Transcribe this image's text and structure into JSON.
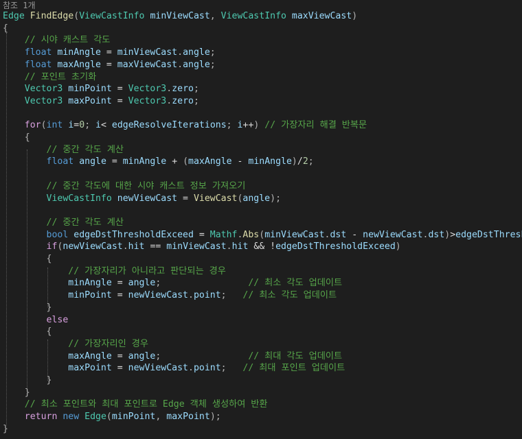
{
  "codelens": {
    "references": "참조 1개"
  },
  "theme": {
    "background": "#1e1e1e",
    "function": "#dcdcaa",
    "type": "#4ec9b0",
    "keyword": "#569cd6",
    "control": "#d8a0df",
    "variable": "#9cdcfe",
    "number": "#b5cea8",
    "comment": "#57a64a",
    "punctuation": "#b4b4b4",
    "plain": "#dcdcdc"
  },
  "code": [
    [
      [
        "type",
        "Edge"
      ],
      [
        "plain",
        " "
      ],
      [
        "fn",
        "FindEdge"
      ],
      [
        "punct",
        "("
      ],
      [
        "type",
        "ViewCastInfo"
      ],
      [
        "plain",
        " "
      ],
      [
        "var",
        "minViewCast"
      ],
      [
        "punct",
        ", "
      ],
      [
        "type",
        "ViewCastInfo"
      ],
      [
        "plain",
        " "
      ],
      [
        "var",
        "maxViewCast"
      ],
      [
        "punct",
        ")"
      ]
    ],
    [
      [
        "punct",
        "{"
      ]
    ],
    [
      [
        "plain",
        "    "
      ],
      [
        "cmt",
        "// 시야 캐스트 각도"
      ]
    ],
    [
      [
        "plain",
        "    "
      ],
      [
        "kw",
        "float"
      ],
      [
        "plain",
        " "
      ],
      [
        "var",
        "minAngle"
      ],
      [
        "plain",
        " = "
      ],
      [
        "var",
        "minViewCast"
      ],
      [
        "punct",
        "."
      ],
      [
        "var",
        "angle"
      ],
      [
        "punct",
        ";"
      ]
    ],
    [
      [
        "plain",
        "    "
      ],
      [
        "kw",
        "float"
      ],
      [
        "plain",
        " "
      ],
      [
        "var",
        "maxAngle"
      ],
      [
        "plain",
        " = "
      ],
      [
        "var",
        "maxViewCast"
      ],
      [
        "punct",
        "."
      ],
      [
        "var",
        "angle"
      ],
      [
        "punct",
        ";"
      ]
    ],
    [
      [
        "plain",
        "    "
      ],
      [
        "cmt",
        "// 포인트 초기화"
      ]
    ],
    [
      [
        "plain",
        "    "
      ],
      [
        "type",
        "Vector3"
      ],
      [
        "plain",
        " "
      ],
      [
        "var",
        "minPoint"
      ],
      [
        "plain",
        " = "
      ],
      [
        "type",
        "Vector3"
      ],
      [
        "punct",
        "."
      ],
      [
        "var",
        "zero"
      ],
      [
        "punct",
        ";"
      ]
    ],
    [
      [
        "plain",
        "    "
      ],
      [
        "type",
        "Vector3"
      ],
      [
        "plain",
        " "
      ],
      [
        "var",
        "maxPoint"
      ],
      [
        "plain",
        " = "
      ],
      [
        "type",
        "Vector3"
      ],
      [
        "punct",
        "."
      ],
      [
        "var",
        "zero"
      ],
      [
        "punct",
        ";"
      ]
    ],
    [],
    [
      [
        "plain",
        "    "
      ],
      [
        "ctl",
        "for"
      ],
      [
        "punct",
        "("
      ],
      [
        "kw",
        "int"
      ],
      [
        "plain",
        " "
      ],
      [
        "var",
        "i"
      ],
      [
        "plain",
        "="
      ],
      [
        "num",
        "0"
      ],
      [
        "punct",
        "; "
      ],
      [
        "var",
        "i"
      ],
      [
        "plain",
        "< "
      ],
      [
        "var",
        "edgeResolveIterations"
      ],
      [
        "punct",
        "; "
      ],
      [
        "var",
        "i"
      ],
      [
        "plain",
        "++"
      ],
      [
        "punct",
        ")"
      ],
      [
        "plain",
        " "
      ],
      [
        "cmt",
        "// 가장자리 해결 반복문"
      ]
    ],
    [
      [
        "plain",
        "    "
      ],
      [
        "punct",
        "{"
      ]
    ],
    [
      [
        "plain",
        "        "
      ],
      [
        "cmt",
        "// 중간 각도 계산"
      ]
    ],
    [
      [
        "plain",
        "        "
      ],
      [
        "kw",
        "float"
      ],
      [
        "plain",
        " "
      ],
      [
        "var",
        "angle"
      ],
      [
        "plain",
        " = "
      ],
      [
        "var",
        "minAngle"
      ],
      [
        "plain",
        " + "
      ],
      [
        "punct",
        "("
      ],
      [
        "var",
        "maxAngle"
      ],
      [
        "plain",
        " - "
      ],
      [
        "var",
        "minAngle"
      ],
      [
        "punct",
        ")"
      ],
      [
        "plain",
        "/"
      ],
      [
        "num",
        "2"
      ],
      [
        "punct",
        ";"
      ]
    ],
    [],
    [
      [
        "plain",
        "        "
      ],
      [
        "cmt",
        "// 중간 각도에 대한 시야 캐스트 정보 가져오기"
      ]
    ],
    [
      [
        "plain",
        "        "
      ],
      [
        "type",
        "ViewCastInfo"
      ],
      [
        "plain",
        " "
      ],
      [
        "var",
        "newViewCast"
      ],
      [
        "plain",
        " = "
      ],
      [
        "fn",
        "ViewCast"
      ],
      [
        "punct",
        "("
      ],
      [
        "var",
        "angle"
      ],
      [
        "punct",
        ");"
      ]
    ],
    [],
    [
      [
        "plain",
        "        "
      ],
      [
        "cmt",
        "// 중간 각도 계산"
      ]
    ],
    [
      [
        "plain",
        "        "
      ],
      [
        "kw",
        "bool"
      ],
      [
        "plain",
        " "
      ],
      [
        "var",
        "edgeDstThresholdExceed"
      ],
      [
        "plain",
        " = "
      ],
      [
        "type",
        "Mathf"
      ],
      [
        "punct",
        "."
      ],
      [
        "fn",
        "Abs"
      ],
      [
        "punct",
        "("
      ],
      [
        "var",
        "minViewCast"
      ],
      [
        "punct",
        "."
      ],
      [
        "var",
        "dst"
      ],
      [
        "plain",
        " - "
      ],
      [
        "var",
        "newViewCast"
      ],
      [
        "punct",
        "."
      ],
      [
        "var",
        "dst"
      ],
      [
        "punct",
        ")"
      ],
      [
        "plain",
        ">"
      ],
      [
        "var",
        "edgeDstThreshold"
      ],
      [
        "punct",
        ";"
      ]
    ],
    [
      [
        "plain",
        "        "
      ],
      [
        "ctl",
        "if"
      ],
      [
        "punct",
        "("
      ],
      [
        "var",
        "newViewCast"
      ],
      [
        "punct",
        "."
      ],
      [
        "var",
        "hit"
      ],
      [
        "plain",
        " == "
      ],
      [
        "var",
        "minViewCast"
      ],
      [
        "punct",
        "."
      ],
      [
        "var",
        "hit"
      ],
      [
        "plain",
        " && !"
      ],
      [
        "var",
        "edgeDstThresholdExceed"
      ],
      [
        "punct",
        ")"
      ]
    ],
    [
      [
        "plain",
        "        "
      ],
      [
        "punct",
        "{"
      ]
    ],
    [
      [
        "plain",
        "            "
      ],
      [
        "cmt",
        "// 가장자리가 아니라고 판단되는 경우"
      ]
    ],
    [
      [
        "plain",
        "            "
      ],
      [
        "var",
        "minAngle"
      ],
      [
        "plain",
        " = "
      ],
      [
        "var",
        "angle"
      ],
      [
        "punct",
        ";"
      ],
      [
        "plain",
        "                "
      ],
      [
        "cmt",
        "// 최소 각도 업데이트"
      ]
    ],
    [
      [
        "plain",
        "            "
      ],
      [
        "var",
        "minPoint"
      ],
      [
        "plain",
        " = "
      ],
      [
        "var",
        "newViewCast"
      ],
      [
        "punct",
        "."
      ],
      [
        "var",
        "point"
      ],
      [
        "punct",
        ";"
      ],
      [
        "plain",
        "   "
      ],
      [
        "cmt",
        "// 최소 각도 업데이트"
      ]
    ],
    [
      [
        "plain",
        "        "
      ],
      [
        "punct",
        "}"
      ]
    ],
    [
      [
        "plain",
        "        "
      ],
      [
        "ctl",
        "else"
      ]
    ],
    [
      [
        "plain",
        "        "
      ],
      [
        "punct",
        "{"
      ]
    ],
    [
      [
        "plain",
        "            "
      ],
      [
        "cmt",
        "// 가장자리인 경우"
      ]
    ],
    [
      [
        "plain",
        "            "
      ],
      [
        "var",
        "maxAngle"
      ],
      [
        "plain",
        " = "
      ],
      [
        "var",
        "angle"
      ],
      [
        "punct",
        ";"
      ],
      [
        "plain",
        "                "
      ],
      [
        "cmt",
        "// 최대 각도 업데이트"
      ]
    ],
    [
      [
        "plain",
        "            "
      ],
      [
        "var",
        "maxPoint"
      ],
      [
        "plain",
        " = "
      ],
      [
        "var",
        "newViewCast"
      ],
      [
        "punct",
        "."
      ],
      [
        "var",
        "point"
      ],
      [
        "punct",
        ";"
      ],
      [
        "plain",
        "   "
      ],
      [
        "cmt",
        "// 최대 포인트 업데이트"
      ]
    ],
    [
      [
        "plain",
        "        "
      ],
      [
        "punct",
        "}"
      ]
    ],
    [
      [
        "plain",
        "    "
      ],
      [
        "punct",
        "}"
      ]
    ],
    [
      [
        "plain",
        "    "
      ],
      [
        "cmt",
        "// 최소 포인트와 최대 포인트로 Edge 객체 생성하여 반환"
      ]
    ],
    [
      [
        "plain",
        "    "
      ],
      [
        "ctl",
        "return"
      ],
      [
        "plain",
        " "
      ],
      [
        "kw",
        "new"
      ],
      [
        "plain",
        " "
      ],
      [
        "type",
        "Edge"
      ],
      [
        "punct",
        "("
      ],
      [
        "var",
        "minPoint"
      ],
      [
        "punct",
        ", "
      ],
      [
        "var",
        "maxPoint"
      ],
      [
        "punct",
        ");"
      ]
    ],
    [
      [
        "punct",
        "}"
      ]
    ]
  ]
}
